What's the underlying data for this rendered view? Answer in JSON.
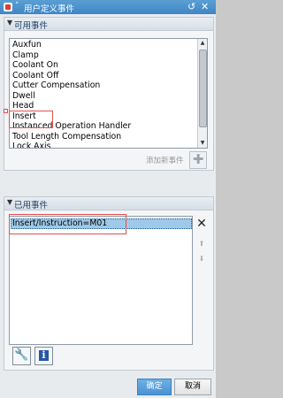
{
  "window": {
    "title": "用户定义事件",
    "collapse_glyph": "˅",
    "reset_icon": "reset-icon",
    "close_icon": "close-icon"
  },
  "available": {
    "header": "可用事件",
    "items": [
      "Auxfun",
      "Clamp",
      "Coolant On",
      "Coolant Off",
      "Cutter Compensation",
      "Dwell",
      "Head",
      "Insert",
      "Instanced Operation Handler",
      "Tool Length Compensation",
      "Lock Axis"
    ],
    "highlighted_item": "Insert",
    "add_label": "添加新事件"
  },
  "used": {
    "header": "已用事件",
    "items": [
      "Insert/Instruction=M01"
    ]
  },
  "footer": {
    "ok": "确定",
    "cancel": "取消"
  },
  "colors": {
    "titlebar": "#4a90cc",
    "selection": "#9fc9e8",
    "highlight_box": "#e05050"
  }
}
